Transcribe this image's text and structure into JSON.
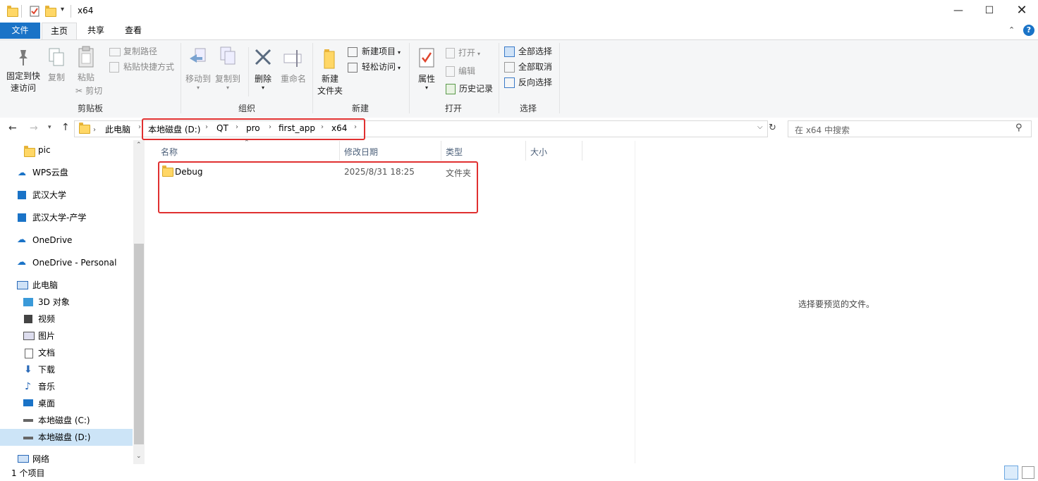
{
  "window": {
    "title": "x64"
  },
  "tabs": {
    "file": "文件",
    "home": "主页",
    "share": "共享",
    "view": "查看"
  },
  "clipboard": {
    "pin_label_1": "固定到快",
    "pin_label_2": "速访问",
    "copy": "复制",
    "paste": "粘贴",
    "copy_path": "复制路径",
    "paste_shortcut": "粘贴快捷方式",
    "cut": "剪切",
    "group": "剪贴板"
  },
  "organize": {
    "move_to": "移动到",
    "copy_to": "复制到",
    "delete": "删除",
    "rename": "重命名",
    "group": "组织"
  },
  "new": {
    "new_item": "新建项目",
    "easy_access": "轻松访问",
    "new_folder_1": "新建",
    "new_folder_2": "文件夹",
    "group": "新建"
  },
  "open": {
    "properties": "属性",
    "open": "打开",
    "edit": "编辑",
    "history": "历史记录",
    "group": "打开"
  },
  "select": {
    "select_all": "全部选择",
    "select_none": "全部取消",
    "invert": "反向选择",
    "group": "选择"
  },
  "address": {
    "crumbs": [
      "此电脑",
      "本地磁盘 (D:)",
      "QT",
      "pro",
      "first_app",
      "x64"
    ],
    "search_placeholder": "在 x64 中搜索"
  },
  "nav": {
    "items": [
      "pic",
      "WPS云盘",
      "武汉大学",
      "武汉大学-产学",
      "OneDrive",
      "OneDrive - Personal",
      "此电脑",
      "3D 对象",
      "视频",
      "图片",
      "文档",
      "下载",
      "音乐",
      "桌面",
      "本地磁盘 (C:)",
      "本地磁盘 (D:)",
      "网络"
    ]
  },
  "columns": {
    "name": "名称",
    "modified": "修改日期",
    "type": "类型",
    "size": "大小"
  },
  "files": [
    {
      "name": "Debug",
      "modified": "2025/8/31 18:25",
      "type": "文件夹",
      "size": ""
    }
  ],
  "preview": {
    "text": "选择要预览的文件。"
  },
  "status": {
    "count": "1 个项目"
  },
  "colors": {
    "accent": "#1a73c7",
    "highlight": "#e03030",
    "folder": "#ffd766"
  }
}
